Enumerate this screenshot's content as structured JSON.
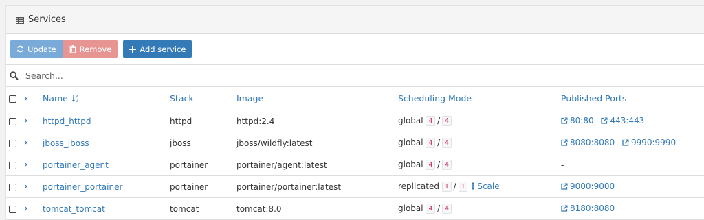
{
  "header": {
    "title": "Services"
  },
  "toolbar": {
    "update_label": "Update",
    "remove_label": "Remove",
    "add_label": "Add service"
  },
  "search": {
    "placeholder": "Search..."
  },
  "table": {
    "columns": [
      "Name",
      "Stack",
      "Image",
      "Scheduling Mode",
      "Published Ports"
    ],
    "rows": [
      {
        "name": "httpd_httpd",
        "stack": "httpd",
        "image": "httpd:2.4",
        "mode": "global",
        "running": "4",
        "desired": "4",
        "ports": [
          "80:80",
          "443:443"
        ]
      },
      {
        "name": "jboss_jboss",
        "stack": "jboss",
        "image": "jboss/wildfly:latest",
        "mode": "global",
        "running": "4",
        "desired": "4",
        "ports": [
          "8080:8080",
          "9990:9990"
        ]
      },
      {
        "name": "portainer_agent",
        "stack": "portainer",
        "image": "portainer/agent:latest",
        "mode": "global",
        "running": "4",
        "desired": "4",
        "ports_text": "-"
      },
      {
        "name": "portainer_portainer",
        "stack": "portainer",
        "image": "portainer/portainer:latest",
        "mode": "replicated",
        "running": "1",
        "desired": "1",
        "scale_label": "Scale",
        "ports": [
          "9000:9000"
        ]
      },
      {
        "name": "tomcat_tomcat",
        "stack": "tomcat",
        "image": "tomcat:8.0",
        "mode": "global",
        "running": "4",
        "desired": "4",
        "ports": [
          "8180:8080"
        ]
      }
    ],
    "separator": "/"
  },
  "colors": {
    "link": "#337ab7",
    "update": "#7aaad8",
    "remove": "#e69593",
    "add": "#337ab7",
    "badge_text": "#c7254e"
  },
  "icons": {
    "header": "list-icon",
    "update": "refresh-icon",
    "remove": "trash-icon",
    "add": "plus-icon",
    "search": "search-icon",
    "sort": "sort-alpha-icon",
    "port": "external-link-icon",
    "scale": "arrows-vertical-icon",
    "expand": "chevron-right-icon"
  }
}
